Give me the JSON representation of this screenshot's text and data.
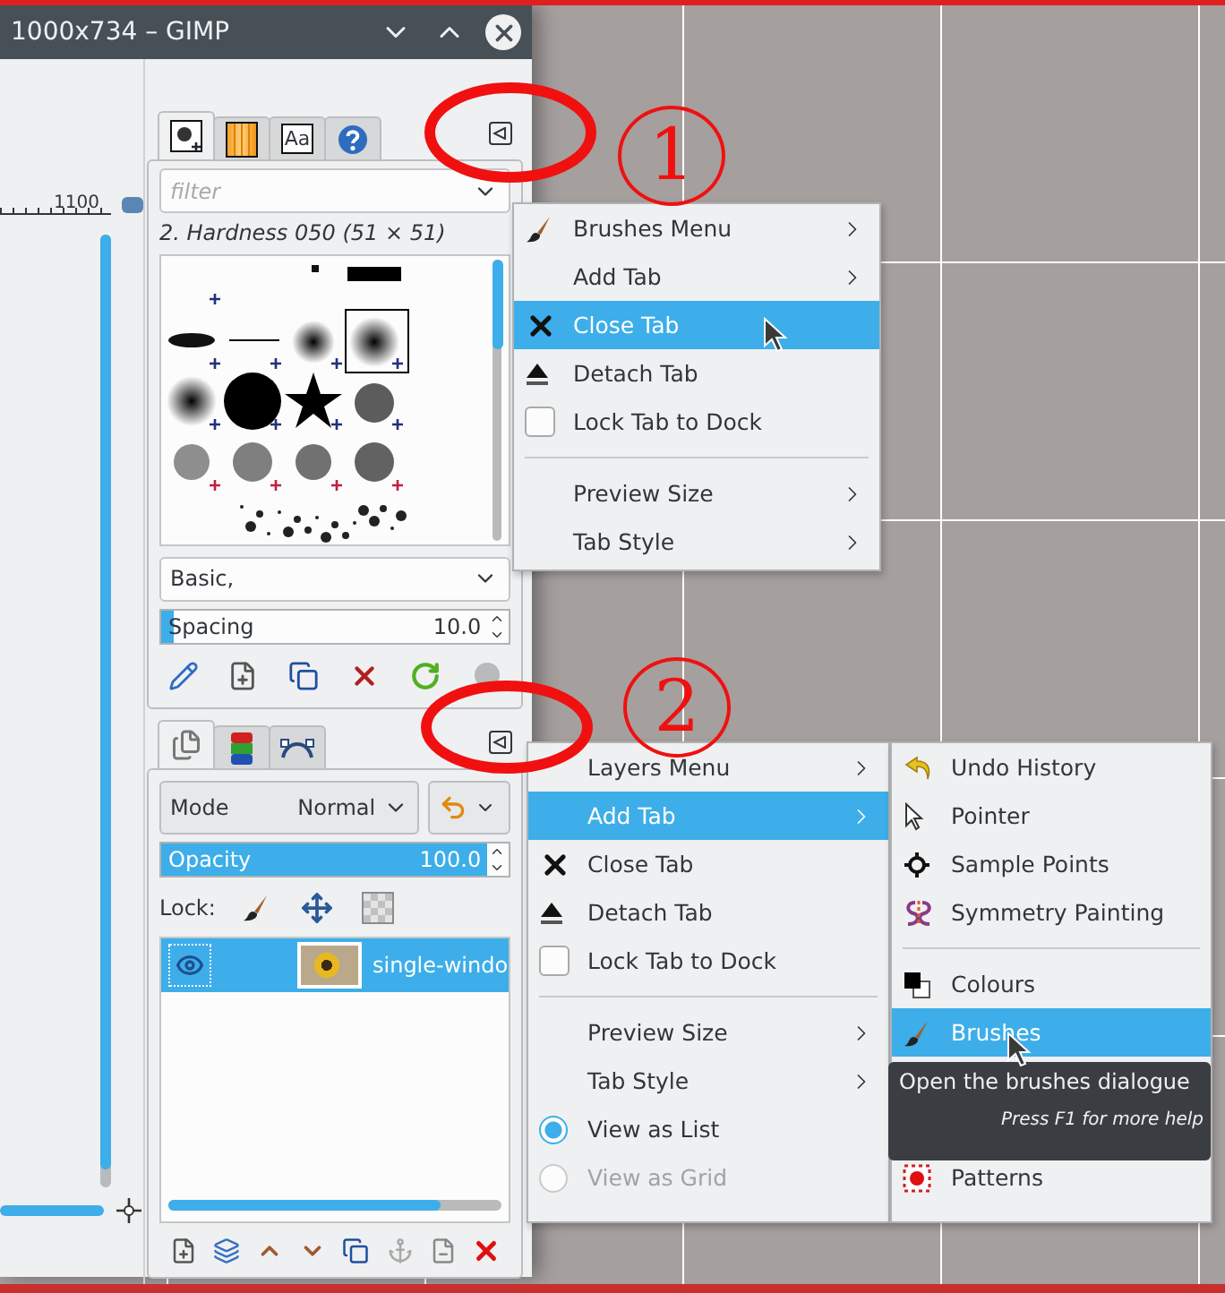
{
  "window": {
    "title": "1000x734 – GIMP"
  },
  "canvas": {
    "ruler_label": "1100"
  },
  "brushes_dock": {
    "tabs": [
      {
        "kind": "brush",
        "selected": true
      },
      {
        "kind": "gradient",
        "selected": false
      },
      {
        "kind": "font",
        "label": "Aa",
        "selected": false
      },
      {
        "kind": "help",
        "selected": false
      }
    ],
    "filter": {
      "placeholder": "filter"
    },
    "brush_name": "2. Hardness 050 (51 × 51)",
    "tag_field": {
      "value": "Basic,"
    },
    "spacing": {
      "label": "Spacing",
      "value": "10.0",
      "level": 0.04
    }
  },
  "layers_dock": {
    "tabs": [
      {
        "kind": "layers",
        "selected": true
      },
      {
        "kind": "channels",
        "selected": false
      },
      {
        "kind": "paths",
        "selected": false
      }
    ],
    "mode": {
      "label": "Mode",
      "value": "Normal"
    },
    "opacity": {
      "label": "Opacity",
      "value": "100.0",
      "level": 1
    },
    "lock_label": "Lock:",
    "layers": [
      {
        "name": "single-windo",
        "selected": true
      }
    ]
  },
  "menus": [
    {
      "items": [
        {
          "kind": "brush",
          "label": "Brushes Menu",
          "selected": false,
          "submenu": true
        },
        {
          "kind": "plain",
          "label": "Add Tab",
          "selected": false,
          "submenu": true
        },
        {
          "kind": "close",
          "label": "Close Tab",
          "selected": true,
          "submenu": false
        },
        {
          "kind": "detach",
          "label": "Detach Tab",
          "selected": false,
          "submenu": false
        },
        {
          "kind": "check",
          "label": "Lock Tab to Dock",
          "selected": false,
          "submenu": false,
          "checked": false
        },
        {
          "kind": "separator"
        },
        {
          "kind": "plain",
          "label": "Preview Size",
          "selected": false,
          "submenu": true
        },
        {
          "kind": "plain",
          "label": "Tab Style",
          "selected": false,
          "submenu": true
        }
      ]
    },
    {
      "items": [
        {
          "kind": "plain",
          "label": "Layers Menu",
          "selected": false,
          "submenu": true
        },
        {
          "kind": "plain",
          "label": "Add Tab",
          "selected": true,
          "submenu": true
        },
        {
          "kind": "close",
          "label": "Close Tab",
          "selected": false,
          "submenu": false
        },
        {
          "kind": "detach",
          "label": "Detach Tab",
          "selected": false,
          "submenu": false
        },
        {
          "kind": "check",
          "label": "Lock Tab to Dock",
          "selected": false,
          "submenu": false,
          "checked": false
        },
        {
          "kind": "separator"
        },
        {
          "kind": "plain",
          "label": "Preview Size",
          "selected": false,
          "submenu": true
        },
        {
          "kind": "plain",
          "label": "Tab Style",
          "selected": false,
          "submenu": true
        },
        {
          "kind": "radio",
          "label": "View as List",
          "selected": false,
          "submenu": false,
          "checked": true,
          "disabled": false
        },
        {
          "kind": "radio",
          "label": "View as Grid",
          "selected": false,
          "submenu": false,
          "checked": false,
          "disabled": true
        }
      ]
    }
  ],
  "submenu": {
    "items": [
      {
        "kind": "undo",
        "label": "Undo History",
        "selected": false
      },
      {
        "kind": "pointer",
        "label": "Pointer",
        "selected": false
      },
      {
        "kind": "sample",
        "label": "Sample Points",
        "selected": false
      },
      {
        "kind": "symmetry",
        "label": "Symmetry Painting",
        "selected": false
      },
      {
        "kind": "separator"
      },
      {
        "kind": "colours",
        "label": "Colours",
        "selected": false
      },
      {
        "kind": "brush",
        "label": "Brushes",
        "selected": true
      },
      {
        "kind": "covered"
      },
      {
        "kind": "covered"
      },
      {
        "kind": "patterns",
        "label": "Patterns",
        "selected": false
      }
    ]
  },
  "tooltip": {
    "text": "Open the brushes dialogue",
    "help": "Press F1 for more help"
  },
  "annotations": [
    {
      "number": "1"
    },
    {
      "number": "2"
    }
  ]
}
